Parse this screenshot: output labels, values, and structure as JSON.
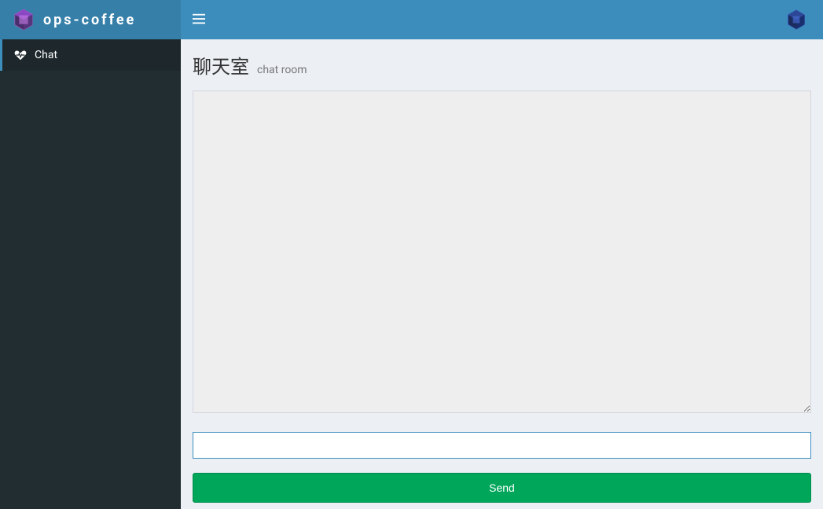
{
  "header": {
    "logo_text": "ops-coffee"
  },
  "sidebar": {
    "items": [
      {
        "label": "Chat"
      }
    ]
  },
  "main": {
    "page_title": "聊天室",
    "page_subtitle": "chat room",
    "chat_log": "",
    "input_value": "",
    "input_placeholder": "",
    "send_button_label": "Send"
  }
}
